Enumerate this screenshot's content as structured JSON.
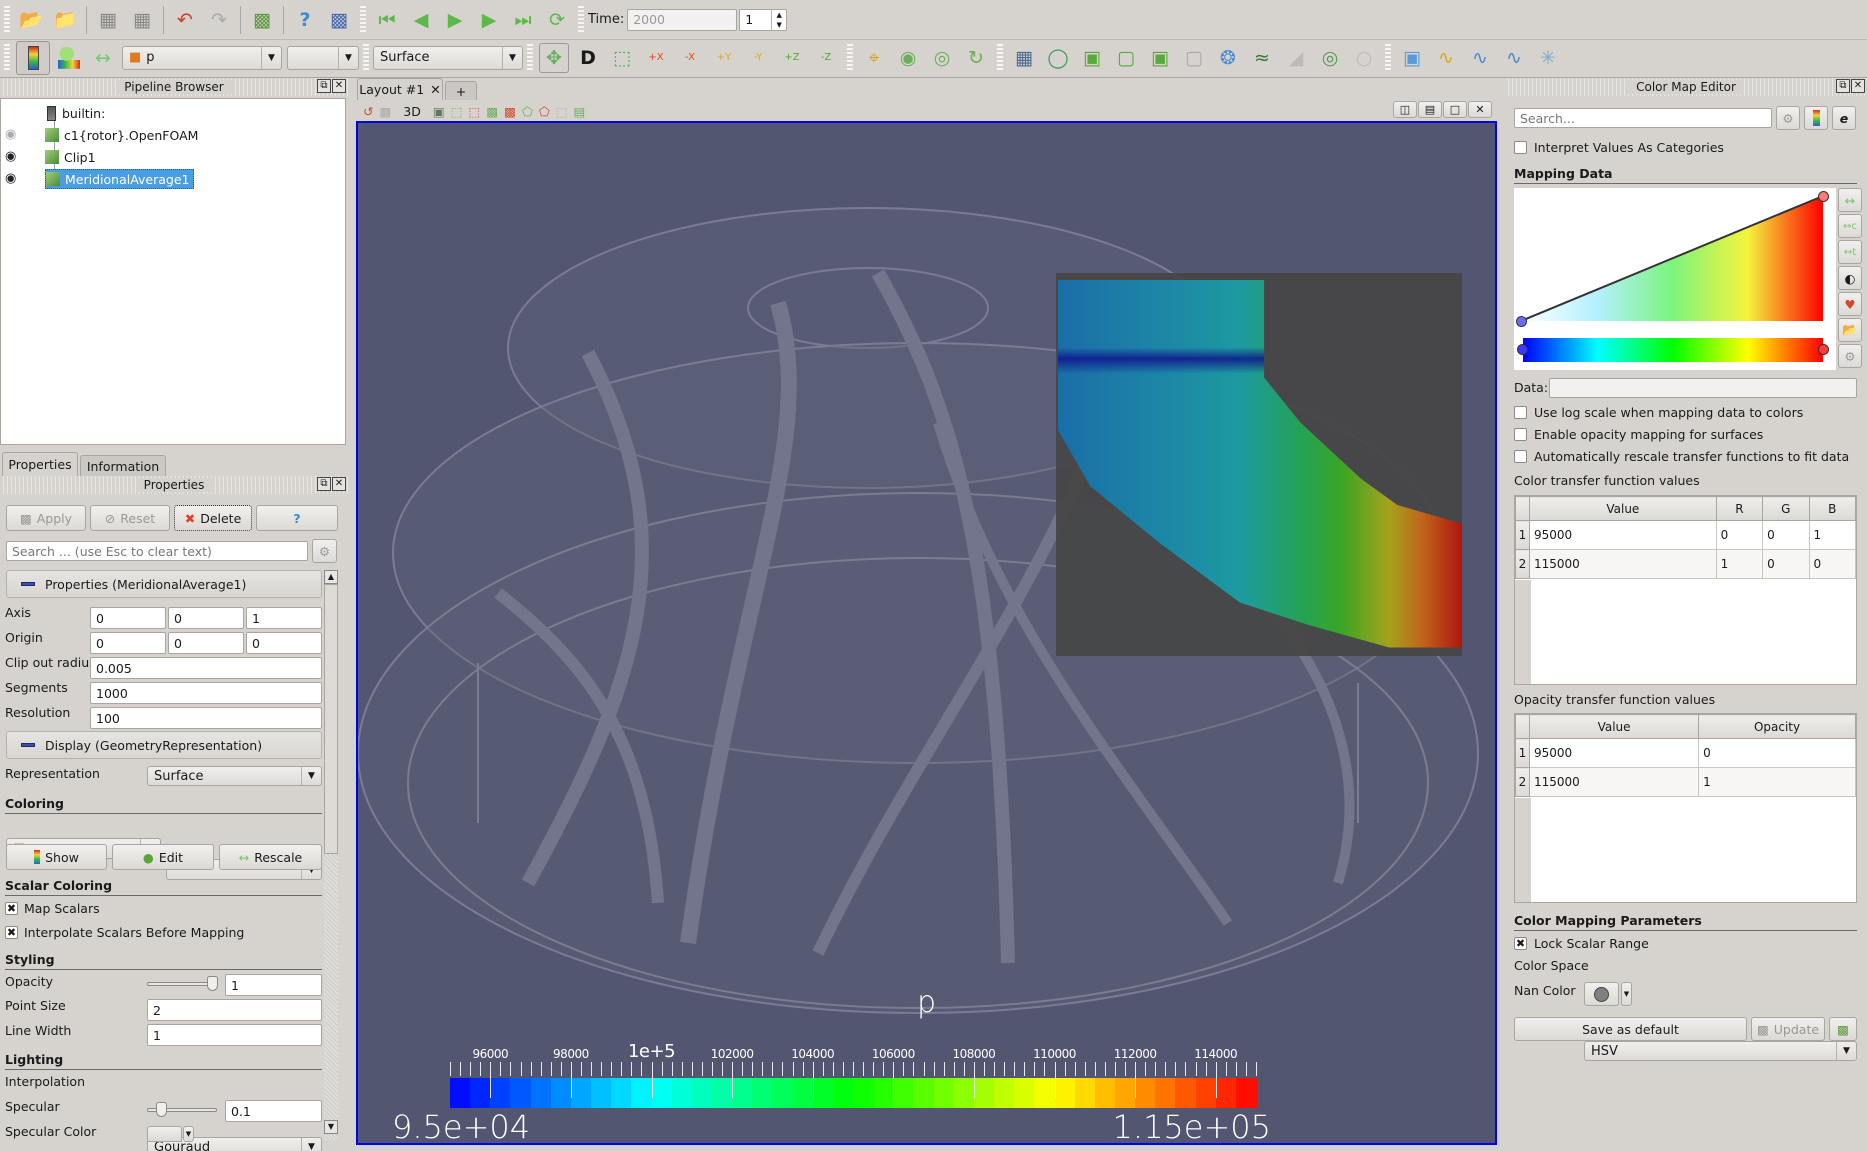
{
  "toolbar1": {
    "icons": [
      "open-icon",
      "load-state-icon",
      "connect-icon",
      "disconnect-icon",
      "undo-icon",
      "redo-icon",
      "find-data-icon",
      "help-icon",
      "pick-center-icon"
    ],
    "vcr": [
      "first-frame-icon",
      "previous-frame-icon",
      "play-icon",
      "next-frame-icon",
      "last-frame-icon",
      "loop-icon"
    ],
    "time_label": "Time:",
    "time_value": "2000",
    "timestep_value": "1"
  },
  "toolbar2": {
    "color_by": "p",
    "component": "",
    "representation": "Surface",
    "camera_labels": [
      "+X",
      "-X",
      "+Y",
      "-Y",
      "+Z",
      "-Z"
    ]
  },
  "pipeline": {
    "title": "Pipeline Browser",
    "items": [
      {
        "label": "builtin:",
        "visible": null,
        "selected": false
      },
      {
        "label": "c1{rotor}.OpenFOAM",
        "visible": false,
        "selected": false
      },
      {
        "label": "Clip1",
        "visible": true,
        "selected": false
      },
      {
        "label": "MeridionalAverage1",
        "visible": true,
        "selected": true
      }
    ]
  },
  "tabs": {
    "properties": "Properties",
    "information": "Information"
  },
  "properties": {
    "title": "Properties",
    "apply": "Apply",
    "reset": "Reset",
    "delete": "Delete",
    "help": "?",
    "search_placeholder": "Search ... (use Esc to clear text)",
    "group1": "Properties (MeridionalAverage1)",
    "axis_label": "Axis",
    "axis": [
      "0",
      "0",
      "1"
    ],
    "origin_label": "Origin",
    "origin": [
      "0",
      "0",
      "0"
    ],
    "clip_label": "Clip out radius",
    "clip": "0.005",
    "segments_label": "Segments",
    "segments": "1000",
    "resolution_label": "Resolution",
    "resolution": "100",
    "group2": "Display (GeometryRepresentation)",
    "representation_label": "Representation",
    "representation": "Surface",
    "coloring_title": "Coloring",
    "color_array": "p",
    "color_component": "",
    "show": "Show",
    "edit": "Edit",
    "rescale": "Rescale",
    "scalar_title": "Scalar Coloring",
    "map_scalars": "Map Scalars",
    "interpolate": "Interpolate Scalars Before Mapping",
    "styling_title": "Styling",
    "opacity_label": "Opacity",
    "opacity": "1",
    "opacity_fraction": 1.0,
    "pointsize_label": "Point Size",
    "pointsize": "2",
    "linewidth_label": "Line Width",
    "linewidth": "1",
    "lighting_title": "Lighting",
    "interp_label": "Interpolation",
    "interp": "Gouraud",
    "specular_label": "Specular",
    "specular": "0.1",
    "specular_fraction": 0.1,
    "specular_color_label": "Specular Color"
  },
  "layout": {
    "tab": "Layout #1",
    "add_tab": "+",
    "view_3d": "3D"
  },
  "viewport": {
    "background": "#525670",
    "scalar_title": "p",
    "scalar_bar": {
      "min_label": "9.5e+04",
      "max_label": "1.15e+05",
      "range": [
        95000,
        115000
      ],
      "ticks": [
        "96000",
        "98000",
        "1e+5",
        "102000",
        "104000",
        "106000",
        "108000",
        "110000",
        "112000",
        "114000"
      ],
      "tick_values": [
        96000,
        98000,
        100000,
        102000,
        104000,
        106000,
        108000,
        110000,
        112000,
        114000
      ]
    }
  },
  "colormap": {
    "title": "Color Map Editor",
    "search_placeholder": "Search...",
    "interpret_categories": "Interpret Values As Categories",
    "mapping_title": "Mapping Data",
    "data_label": "Data:",
    "data_value": "",
    "log_scale": "Use log scale when mapping data to colors",
    "opacity_mapping": "Enable opacity mapping for surfaces",
    "auto_rescale": "Automatically rescale transfer functions to fit data",
    "ctf_title": "Color transfer function values",
    "ctf_headers": [
      "Value",
      "R",
      "G",
      "B"
    ],
    "ctf_rows": [
      [
        "95000",
        "0",
        "0",
        "1"
      ],
      [
        "115000",
        "1",
        "0",
        "0"
      ]
    ],
    "otf_title": "Opacity transfer function values",
    "otf_headers": [
      "Value",
      "Opacity"
    ],
    "otf_rows": [
      [
        "95000",
        "0"
      ],
      [
        "115000",
        "1"
      ]
    ],
    "params_title": "Color Mapping Parameters",
    "lock_range": "Lock Scalar Range",
    "color_space_label": "Color Space",
    "color_space": "HSV",
    "nan_label": "Nan Color",
    "nan_color": "#808080",
    "save_default": "Save as default",
    "update": "Update"
  }
}
